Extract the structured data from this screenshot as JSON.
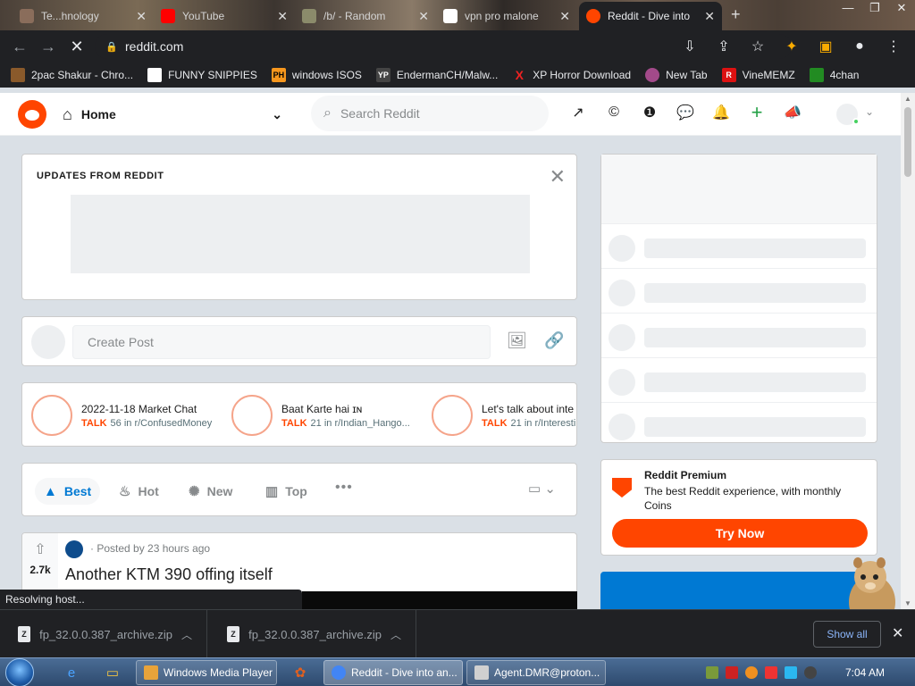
{
  "browser": {
    "tabs": [
      {
        "title": "Te...hnology",
        "favicon_color": "#8a6d5b",
        "active": false
      },
      {
        "title": "YouTube",
        "favicon_color": "#ff0000",
        "active": false
      },
      {
        "title": "/b/ - Random",
        "favicon_color": "#8b8b6b",
        "active": false
      },
      {
        "title": "vpn pro malone",
        "favicon_color": "#ffffff",
        "active": false
      },
      {
        "title": "Reddit - Dive into",
        "favicon_color": "#ff4500",
        "active": true
      }
    ],
    "url": "reddit.com",
    "bookmarks": [
      {
        "label": "2pac Shakur - Chro...",
        "icon": "",
        "color": "#8a5a2b"
      },
      {
        "label": "FUNNY SNIPPIES",
        "icon": "",
        "color": "#2b2b2b"
      },
      {
        "label": "windows ISOS",
        "icon": "PH",
        "color": "#f7971d"
      },
      {
        "label": "EndermanCH/Malw...",
        "icon": "",
        "color": "#2a2a2a"
      },
      {
        "label": "XP Horror Download",
        "icon": "X",
        "color": "#d11"
      },
      {
        "label": "New Tab",
        "icon": "",
        "color": "#a34a8a"
      },
      {
        "label": "VineMEMZ",
        "icon": "R",
        "color": "#d11"
      },
      {
        "label": "4chan",
        "icon": "",
        "color": "#228b22"
      }
    ],
    "status_text": "Resolving host..."
  },
  "reddit": {
    "home_label": "Home",
    "search_placeholder": "Search Reddit",
    "updates_title": "UPDATES FROM REDDIT",
    "create_post_placeholder": "Create Post",
    "talks": [
      {
        "title": "2022-11-18 Market Chat",
        "badge": "TALK",
        "count": "56",
        "community": "in r/ConfusedMoney"
      },
      {
        "title": "Baat Karte hai ɪɴ",
        "badge": "TALK",
        "count": "21",
        "community": "in r/Indian_Hango..."
      },
      {
        "title": "Let's talk about inte",
        "badge": "TALK",
        "count": "21",
        "community": "in r/Interesti"
      }
    ],
    "sort_tabs": [
      {
        "label": "Best",
        "icon": "rocket-icon",
        "active": true
      },
      {
        "label": "Hot",
        "icon": "flame-icon",
        "active": false
      },
      {
        "label": "New",
        "icon": "sparkle-icon",
        "active": false
      },
      {
        "label": "Top",
        "icon": "chart-icon",
        "active": false
      }
    ],
    "post": {
      "votes": "2.7k",
      "meta": "· Posted by 23 hours ago",
      "title": "Another KTM 390 offing itself"
    },
    "premium": {
      "title": "Reddit Premium",
      "description": "The best Reddit experience, with monthly Coins",
      "button": "Try Now"
    },
    "brand_color": "#ff4500",
    "accent_color": "#0079d3"
  },
  "downloads": [
    {
      "filename": "fp_32.0.0.387_archive.zip"
    },
    {
      "filename": "fp_32.0.0.387_archive.zip"
    }
  ],
  "show_all_label": "Show all",
  "taskbar": {
    "tasks": [
      {
        "label": "Windows Media Player",
        "color": "#e8a33a",
        "active": false
      },
      {
        "label": "Reddit - Dive into an...",
        "color": "#4285f4",
        "active": true
      },
      {
        "label": "Agent.DMR@proton...",
        "color": "#d0d0d0",
        "active": false
      }
    ],
    "clock": "7:04 AM"
  }
}
